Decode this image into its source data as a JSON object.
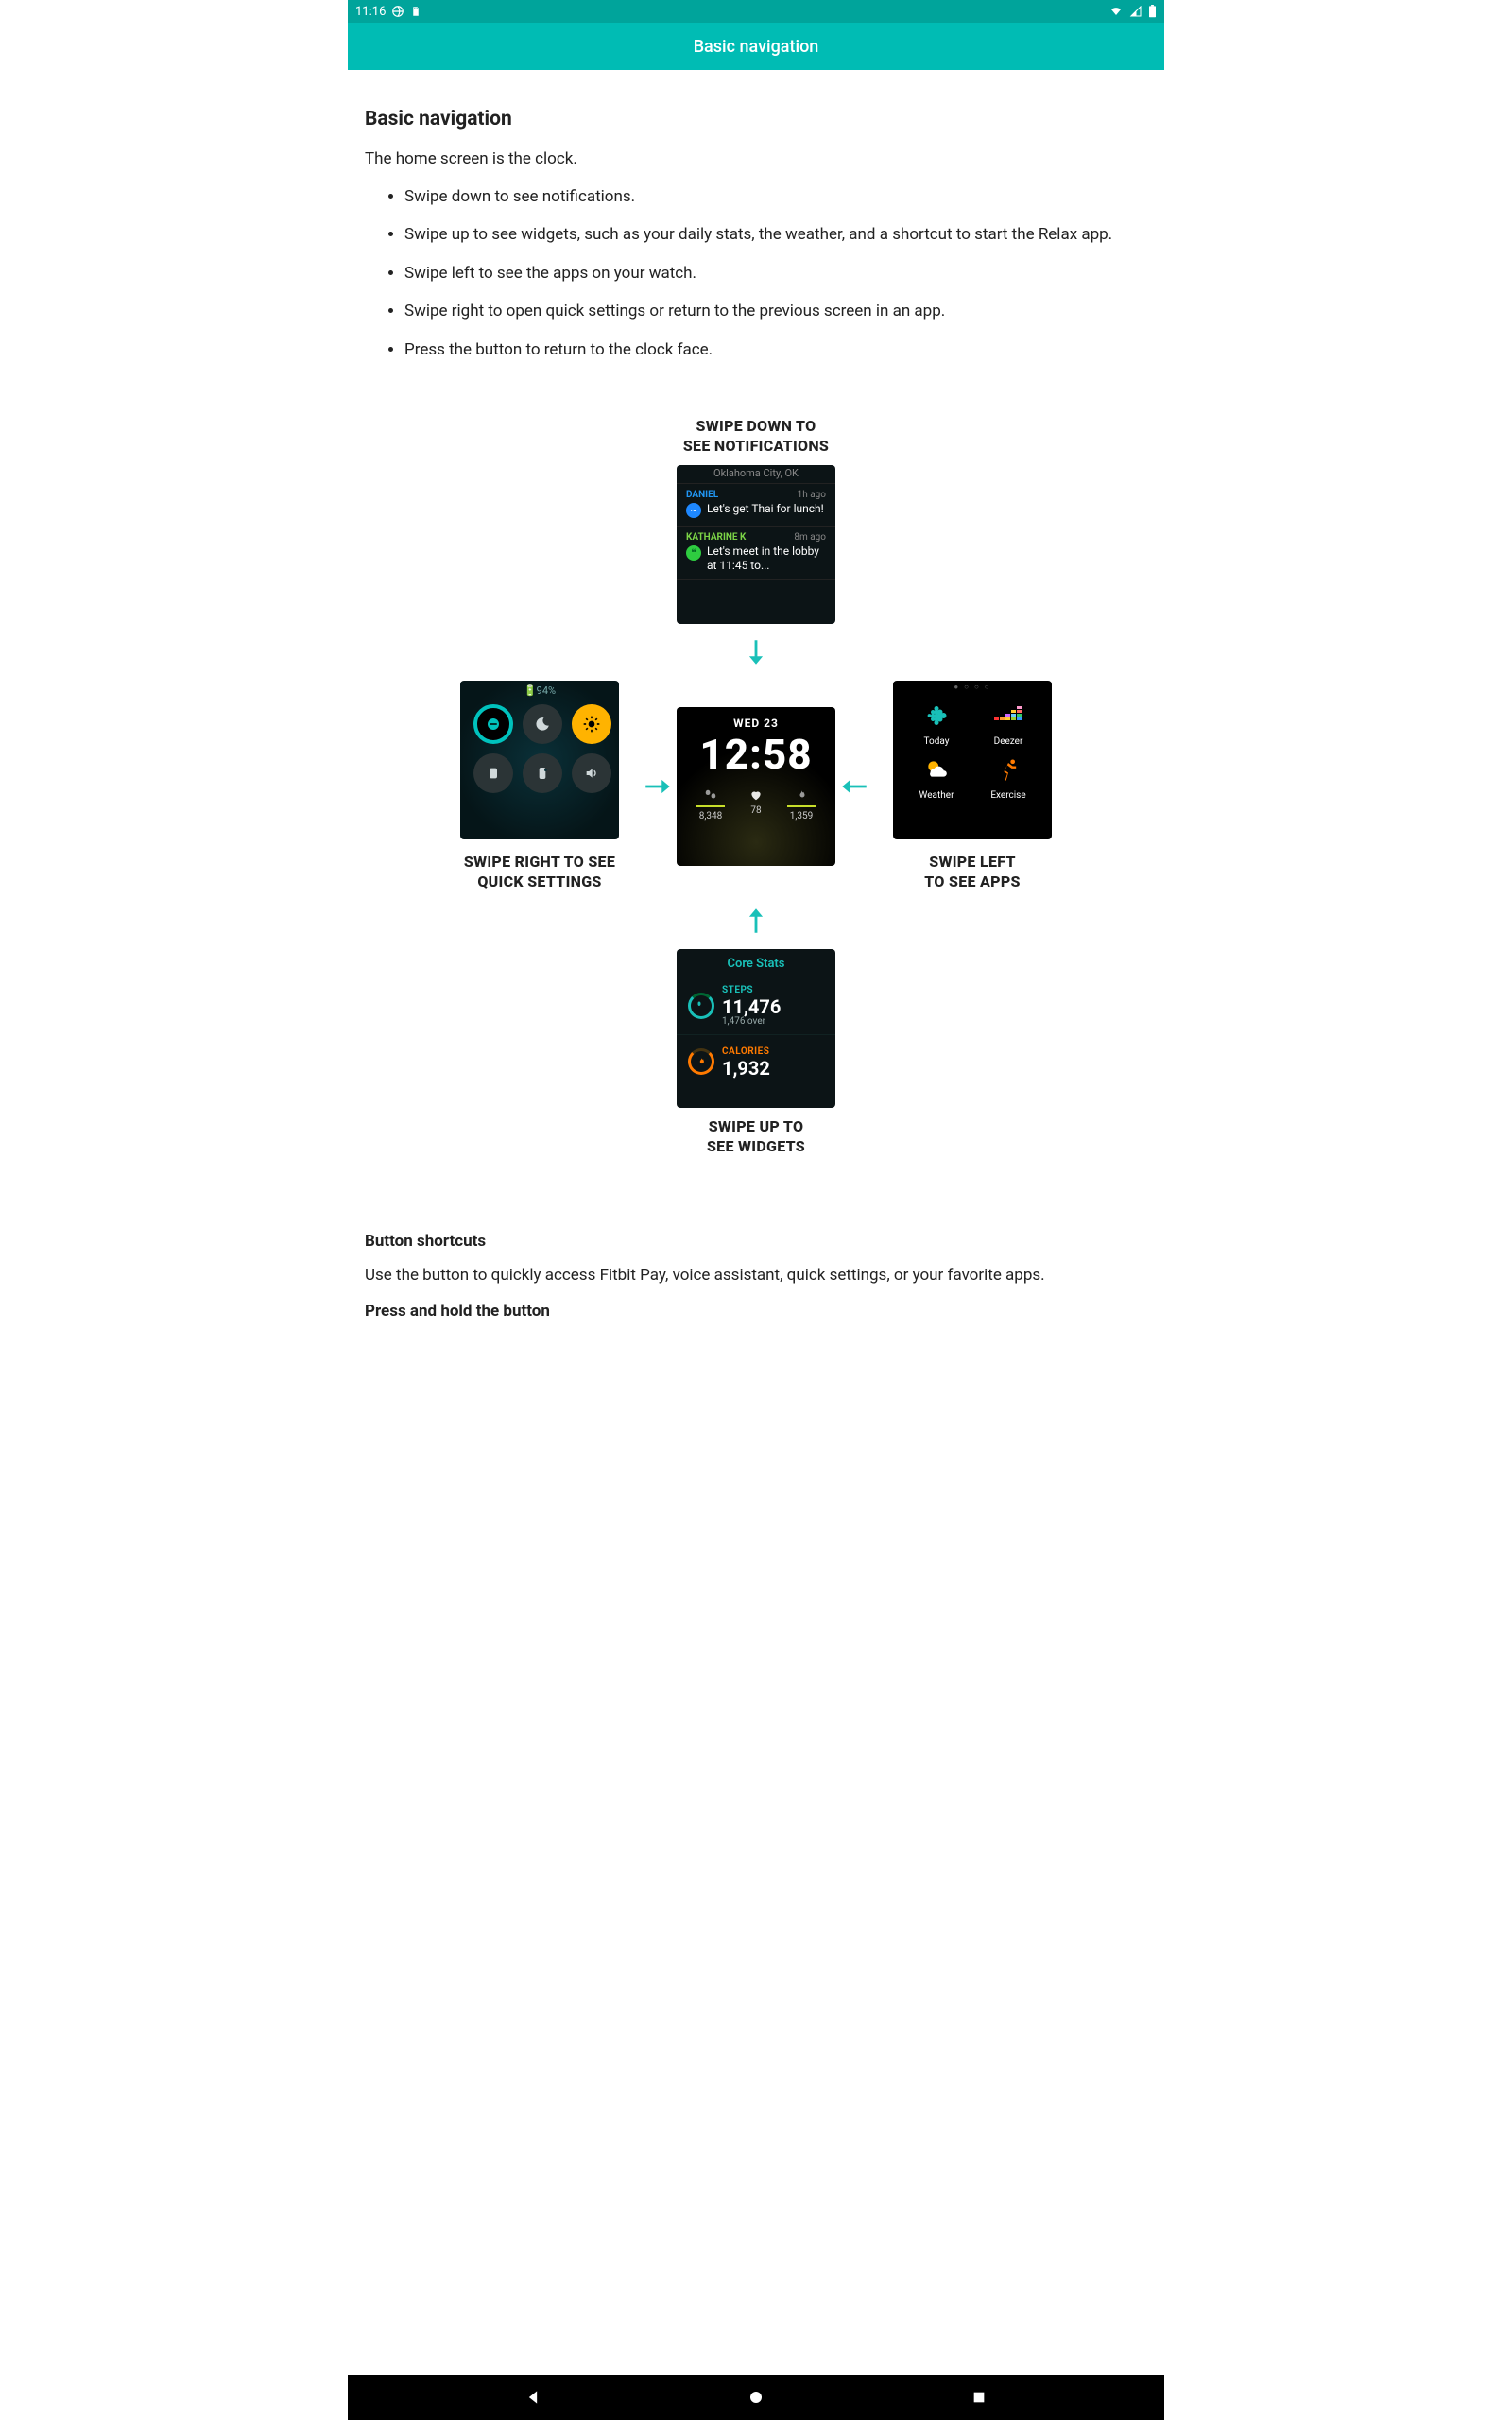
{
  "statusbar": {
    "time": "11:16"
  },
  "appbar": {
    "title": "Basic navigation"
  },
  "section1": {
    "heading": "Basic navigation",
    "intro": "The home screen is the clock.",
    "bullets": [
      "Swipe down to see notifications.",
      "Swipe up to see widgets, such as your daily stats, the weather, and a shortcut to start the Relax app.",
      "Swipe left to see the apps on your watch.",
      "Swipe right to open quick settings or return to the previous screen in an app.",
      "Press the button to return to the clock face."
    ]
  },
  "diagram": {
    "labels": {
      "top1": "SWIPE DOWN TO",
      "top2": "SEE NOTIFICATIONS",
      "right1": "SWIPE LEFT",
      "right2": "TO SEE APPS",
      "bottom1": "SWIPE UP TO",
      "bottom2": "SEE WIDGETS",
      "left1": "SWIPE RIGHT TO SEE",
      "left2": "QUICK SETTINGS"
    },
    "notifications": {
      "location": "Oklahoma City, OK",
      "items": [
        {
          "name": "DANIEL",
          "time": "1h ago",
          "text": "Let's get Thai for lunch!",
          "nameColor": "#2196f3",
          "iconColor": "blue"
        },
        {
          "name": "KATHARINE K",
          "time": "8m ago",
          "text": "Let's meet in the lobby at 11:45 to...",
          "nameColor": "#7bd346",
          "iconColor": "green"
        }
      ]
    },
    "quicksettings": {
      "battery": "94%"
    },
    "clock": {
      "date": "WED 23",
      "time": "12:58",
      "steps": "8,348",
      "hr": "78",
      "cal": "1,359"
    },
    "apps": {
      "cells": [
        "Today",
        "Deezer",
        "Weather",
        "Exercise"
      ]
    },
    "widgets": {
      "title": "Core Stats",
      "stepsLabel": "STEPS",
      "steps": "11,476",
      "stepsSub": "1,476 over",
      "calLabel": "CALORIES",
      "cal": "1,932"
    }
  },
  "section2": {
    "heading": "Button shortcuts",
    "intro": "Use the button to quickly access Fitbit Pay, voice assistant, quick settings, or your favorite apps.",
    "sub": "Press and hold the button"
  }
}
